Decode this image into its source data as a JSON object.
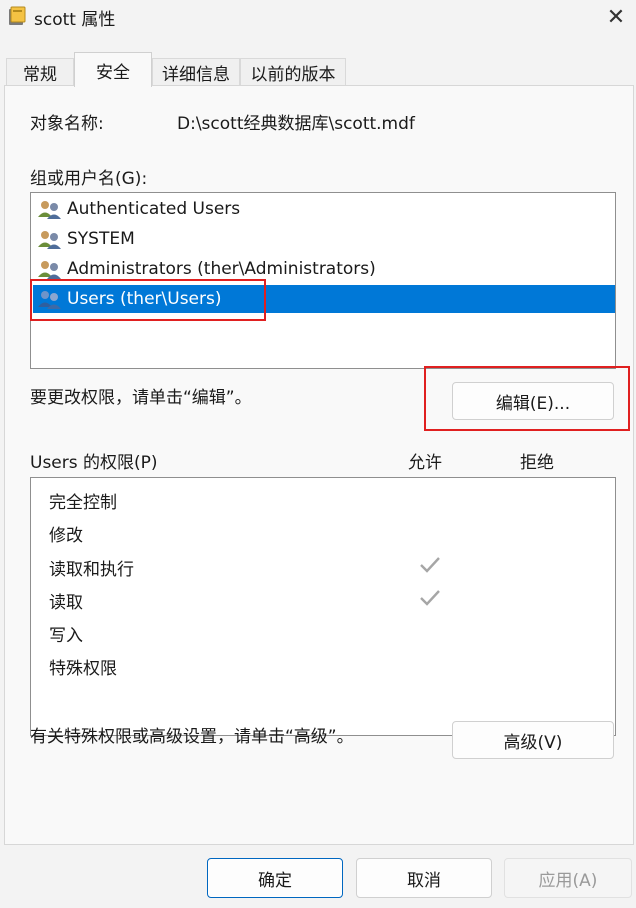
{
  "window": {
    "title": "scott 属性",
    "close_glyph": "✕"
  },
  "tabs": [
    {
      "label": "常规",
      "active": false
    },
    {
      "label": "安全",
      "active": true
    },
    {
      "label": "详细信息",
      "active": false
    },
    {
      "label": "以前的版本",
      "active": false
    }
  ],
  "security": {
    "object_name_label": "对象名称:",
    "object_name_value": "D:\\scott经典数据库\\scott.mdf",
    "groups_label": "组或用户名(G):",
    "users": [
      {
        "label": "Authenticated Users",
        "icon": "users-group-icon",
        "selected": false
      },
      {
        "label": "SYSTEM",
        "icon": "users-group-icon",
        "selected": false
      },
      {
        "label": "Administrators (ther\\Administrators)",
        "icon": "users-group-icon",
        "selected": false
      },
      {
        "label": "Users (ther\\Users)",
        "icon": "users-group-icon",
        "selected": true
      }
    ],
    "edit_hint": "要更改权限，请单击“编辑”。",
    "edit_button": "编辑(E)...",
    "permissions_label": "Users 的权限(P)",
    "allow_header": "允许",
    "deny_header": "拒绝",
    "permissions": [
      {
        "name": "完全控制",
        "allow": false,
        "deny": false
      },
      {
        "name": "修改",
        "allow": false,
        "deny": false
      },
      {
        "name": "读取和执行",
        "allow": true,
        "deny": false
      },
      {
        "name": "读取",
        "allow": true,
        "deny": false
      },
      {
        "name": "写入",
        "allow": false,
        "deny": false
      },
      {
        "name": "特殊权限",
        "allow": false,
        "deny": false
      }
    ],
    "advanced_hint": "有关特殊权限或高级设置，请单击“高级”。",
    "advanced_button": "高级(V)"
  },
  "footer": {
    "ok": "确定",
    "cancel": "取消",
    "apply": "应用(A)"
  },
  "colors": {
    "selection": "#0078d7",
    "highlight_box": "#e02020",
    "check": "#a6a6a6"
  }
}
